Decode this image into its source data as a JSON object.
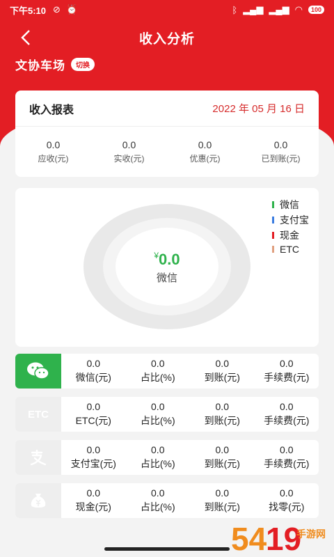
{
  "status": {
    "time": "下午5:10",
    "battery": "100"
  },
  "nav": {
    "title": "收入分析"
  },
  "lot": {
    "name": "文协车场",
    "switch_label": "切换"
  },
  "report": {
    "title": "收入报表",
    "date": "2022 年 05 月 16 日",
    "metrics": [
      {
        "value": "0.0",
        "label": "应收(元)"
      },
      {
        "value": "0.0",
        "label": "实收(元)"
      },
      {
        "value": "0.0",
        "label": "优惠(元)"
      },
      {
        "value": "0.0",
        "label": "已到账(元)"
      }
    ]
  },
  "chart_data": {
    "type": "pie",
    "title": "",
    "categories": [
      "微信",
      "支付宝",
      "现金",
      "ETC"
    ],
    "values": [
      0.0,
      0.0,
      0.0,
      0.0
    ],
    "center_value": "0.0",
    "center_currency": "¥",
    "center_label": "微信",
    "legend_position": "top-right",
    "colors": {
      "微信": "#2fb24c",
      "支付宝": "#3b7de0",
      "现金": "#e31e24",
      "ETC": "#e0a080"
    },
    "empty_ring_color": "#e9e9e9"
  },
  "payments": [
    {
      "icon": "wechat-icon",
      "icon_bg": "#2fb24c",
      "cols": [
        {
          "value": "0.0",
          "label": "微信(元)"
        },
        {
          "value": "0.0",
          "label": "占比(%)"
        },
        {
          "value": "0.0",
          "label": "到账(元)"
        },
        {
          "value": "0.0",
          "label": "手续费(元)"
        }
      ]
    },
    {
      "icon": "etc-icon",
      "icon_text": "ETC",
      "icon_bg": "#eeeeee",
      "cols": [
        {
          "value": "0.0",
          "label": "ETC(元)"
        },
        {
          "value": "0.0",
          "label": "占比(%)"
        },
        {
          "value": "0.0",
          "label": "到账(元)"
        },
        {
          "value": "0.0",
          "label": "手续费(元)"
        }
      ]
    },
    {
      "icon": "alipay-icon",
      "icon_bg": "#eeeeee",
      "cols": [
        {
          "value": "0.0",
          "label": "支付宝(元)"
        },
        {
          "value": "0.0",
          "label": "占比(%)"
        },
        {
          "value": "0.0",
          "label": "到账(元)"
        },
        {
          "value": "0.0",
          "label": "手续费(元)"
        }
      ]
    },
    {
      "icon": "cash-bag-icon",
      "icon_bg": "#eeeeee",
      "cols": [
        {
          "value": "0.0",
          "label": "现金(元)"
        },
        {
          "value": "0.0",
          "label": "占比(%)"
        },
        {
          "value": "0.0",
          "label": "到账(元)"
        },
        {
          "value": "0.0",
          "label": "找零(元)"
        }
      ]
    }
  ],
  "watermark": {
    "text": "5419手游网"
  }
}
